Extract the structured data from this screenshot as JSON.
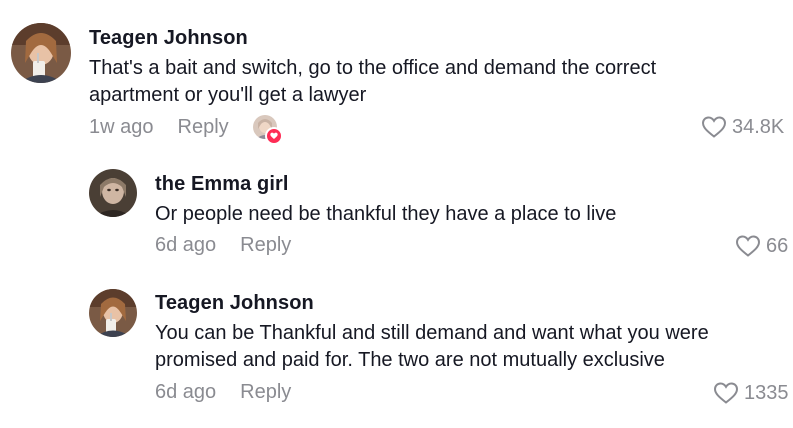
{
  "comments": [
    {
      "username": "Teagen Johnson",
      "text": "That's a bait and switch, go to the office and demand the correct apartment or you'll get a lawyer",
      "time": "1w ago",
      "reply_label": "Reply",
      "likes": "34.8K",
      "creator_liked": true
    },
    {
      "username": "the Emma girl",
      "text": "Or people need be thankful they have a place to live",
      "time": "6d ago",
      "reply_label": "Reply",
      "likes": "66"
    },
    {
      "username": "Teagen Johnson",
      "text": "You can be Thankful and still demand and want what you were promised and paid for. The two are not mutually exclusive",
      "time": "6d ago",
      "reply_label": "Reply",
      "likes": "1335"
    }
  ],
  "colors": {
    "text": "#161823",
    "muted": "#8a8b91",
    "heart_badge": "#fe2c55"
  },
  "icons": {
    "like": "heart-outline-icon",
    "badge": "heart-filled-icon"
  }
}
